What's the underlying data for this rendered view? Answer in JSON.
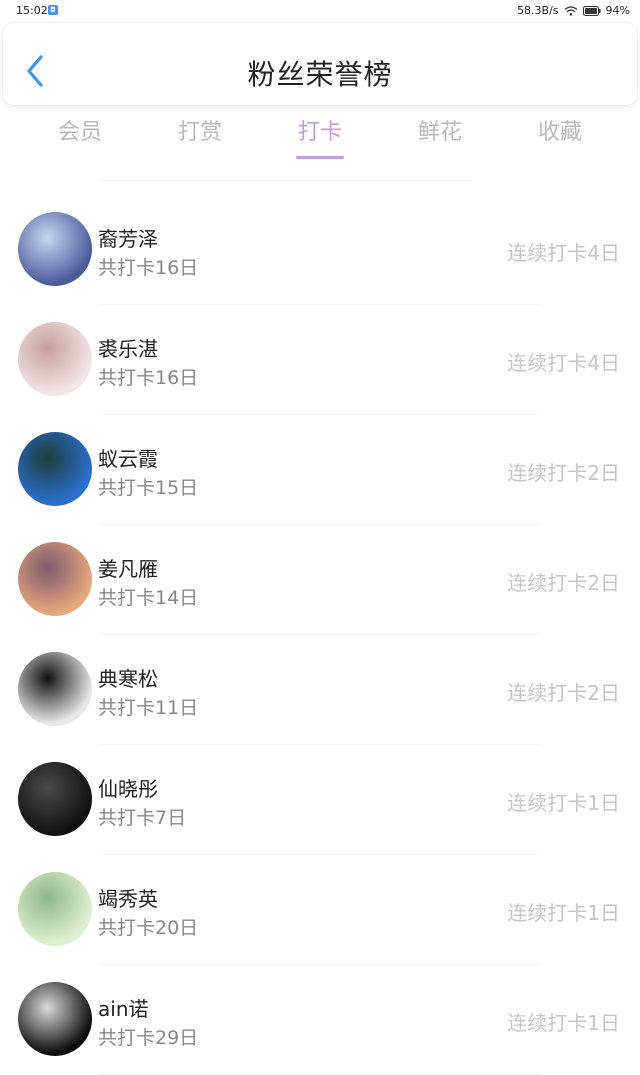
{
  "status_bar": {
    "time": "15:02",
    "app_badge": "◘",
    "network_speed": "58.3B/s",
    "battery": "94%"
  },
  "header": {
    "title": "粉丝荣誉榜",
    "back_icon": "chevron-left-icon"
  },
  "tabs": [
    {
      "label": "会员",
      "active": false
    },
    {
      "label": "打赏",
      "active": false
    },
    {
      "label": "打卡",
      "active": true
    },
    {
      "label": "鲜花",
      "active": false
    },
    {
      "label": "收藏",
      "active": false
    }
  ],
  "colors": {
    "accent": "#c39be0",
    "back_arrow": "#3b96e8"
  },
  "fans": [
    {
      "name": "裔芳泽",
      "total": "共打卡16日",
      "streak": "连续打卡4日",
      "avatar_colors": [
        "#4b5b9a",
        "#c9d6f0"
      ]
    },
    {
      "name": "裘乐湛",
      "total": "共打卡16日",
      "streak": "连续打卡4日",
      "avatar_colors": [
        "#f2e6e6",
        "#c79ea0"
      ]
    },
    {
      "name": "蚁云霞",
      "total": "共打卡15日",
      "streak": "连续打卡2日",
      "avatar_colors": [
        "#2b6fcf",
        "#1e3d3a"
      ]
    },
    {
      "name": "姜凡雁",
      "total": "共打卡14日",
      "streak": "连续打卡2日",
      "avatar_colors": [
        "#e7a77d",
        "#7c5a6e"
      ]
    },
    {
      "name": "典寒松",
      "total": "共打卡11日",
      "streak": "连续打卡2日",
      "avatar_colors": [
        "#e9e9e9",
        "#111111"
      ]
    },
    {
      "name": "仙晓彤",
      "total": "共打卡7日",
      "streak": "连续打卡1日",
      "avatar_colors": [
        "#111111",
        "#4a4a4a"
      ]
    },
    {
      "name": "竭秀英",
      "total": "共打卡20日",
      "streak": "连续打卡1日",
      "avatar_colors": [
        "#dff0d0",
        "#8fb88a"
      ]
    },
    {
      "name": "ain诺",
      "total": "共打卡29日",
      "streak": "连续打卡1日",
      "avatar_colors": [
        "#0c0c0c",
        "#dadada"
      ]
    }
  ]
}
